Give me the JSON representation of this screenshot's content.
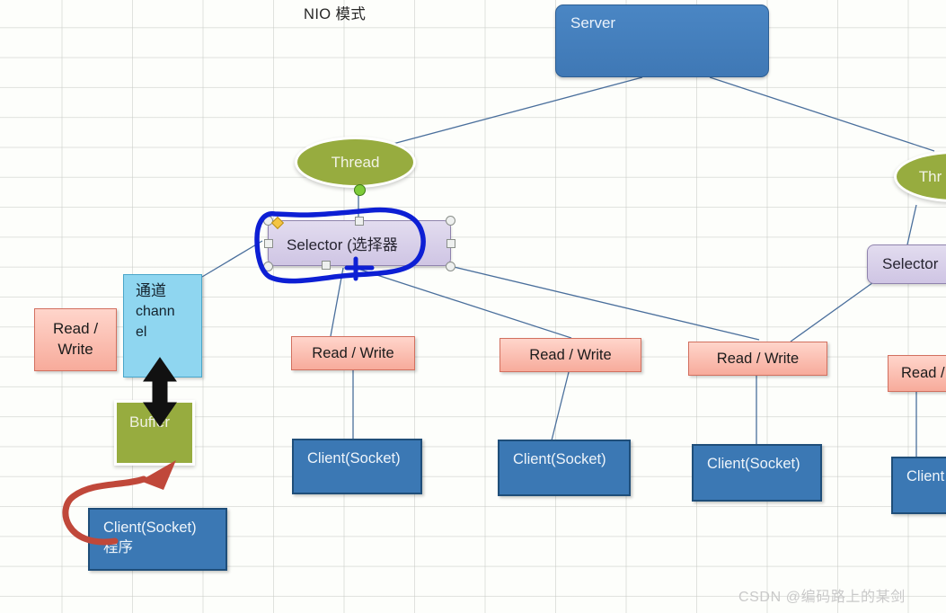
{
  "diagram": {
    "title": "NIO 模式",
    "watermark": "CSDN @编码路上的某剑"
  },
  "nodes": {
    "server": {
      "label": "Server",
      "color": "#4a86c4"
    },
    "thread_left": {
      "label": "Thread",
      "color": "#97ac3f"
    },
    "thread_right": {
      "label": "Thr",
      "color": "#97ac3f"
    },
    "selector_left": {
      "label": "Selector (选择器",
      "color": "#cfc5e4"
    },
    "selector_right": {
      "label": "Selector",
      "color": "#cfc5e4"
    },
    "channel": {
      "line1": "通道",
      "line2": "chann",
      "line3": "el",
      "color": "#8fd6f0"
    },
    "buffer": {
      "label": "Buffer",
      "color": "#97ac3f"
    },
    "client_program": {
      "line1": "Client(Socket)",
      "line2": "程序",
      "color": "#3b78b4"
    },
    "read_write_left": {
      "line1": "Read /",
      "line2": "Write",
      "color": "#f7ab9b"
    },
    "read_write_1": {
      "label": "Read / Write",
      "color": "#f7ab9b"
    },
    "read_write_2": {
      "label": "Read / Write",
      "color": "#f7ab9b"
    },
    "read_write_3": {
      "label": "Read / Write",
      "color": "#f7ab9b"
    },
    "read_write_4": {
      "label": "Read /",
      "color": "#f7ab9b"
    },
    "client_1": {
      "label": "Client(Socket)",
      "color": "#3b78b4"
    },
    "client_2": {
      "label": "Client(Socket)",
      "color": "#3b78b4"
    },
    "client_3": {
      "label": "Client(Socket)",
      "color": "#3b78b4"
    },
    "client_4": {
      "label": "Client",
      "color": "#3b78b4"
    }
  },
  "annotations": {
    "selection_ink_color": "#0d1fd4",
    "red_arrow_color": "#c0483a",
    "connector_color": "#4a6f9c",
    "double_arrow_color": "#111111"
  }
}
